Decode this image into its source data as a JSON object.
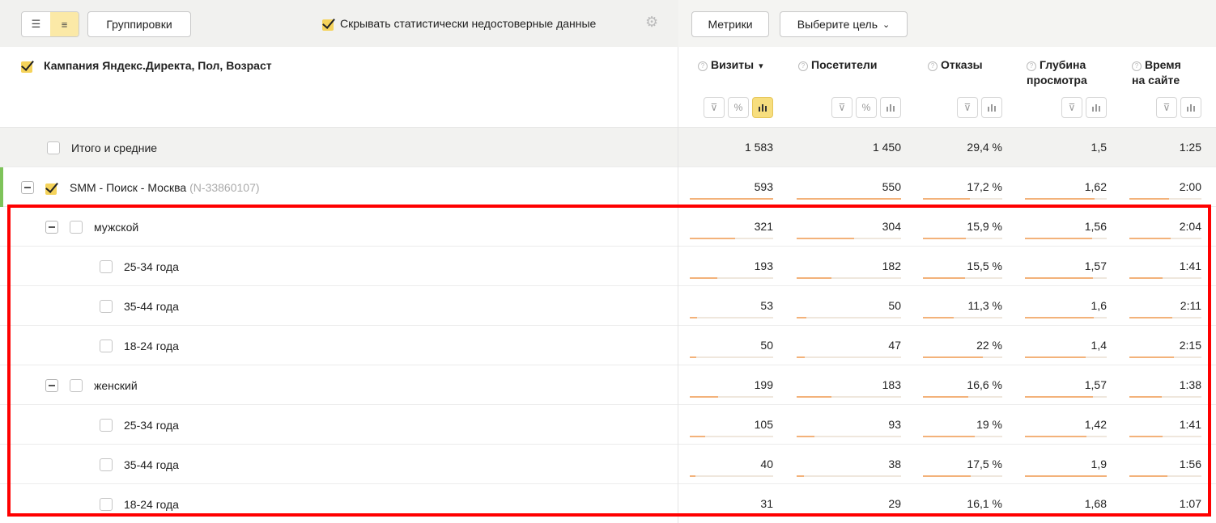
{
  "toolbar": {
    "view_list_icon": "list-icon",
    "view_tree_icon": "tree-icon",
    "groupings_label": "Группировки",
    "hide_unreliable_label": "Скрывать статистически недостоверные данные",
    "hide_unreliable_checked": true,
    "metrics_label": "Метрики",
    "goal_label": "Выберите цель"
  },
  "header": {
    "dimensions_title": "Кампания Яндекс.Директа, Пол, Возраст",
    "metrics": [
      {
        "line1": "Визиты",
        "line2": "",
        "sorted": true,
        "sort_arrow": "▾",
        "tools": [
          "filter",
          "percent",
          "chart"
        ]
      },
      {
        "line1": "Посетители",
        "line2": "",
        "tools": [
          "filter",
          "percent",
          "chart"
        ]
      },
      {
        "line1": "Отказы",
        "line2": "",
        "tools": [
          "filter",
          "chart"
        ]
      },
      {
        "line1": "Глубина",
        "line2": "просмотра",
        "tools": [
          "filter",
          "chart"
        ]
      },
      {
        "line1": "Время",
        "line2": "на сайте",
        "tools": [
          "filter",
          "chart"
        ]
      }
    ]
  },
  "rows": [
    {
      "label": "Итого и средние",
      "id": "",
      "level": 0,
      "type": "total",
      "values": [
        "1 583",
        "1 450",
        "29,4 %",
        "1,5",
        "1:25"
      ],
      "bars": null
    },
    {
      "label": "SMM - Поиск - Москва",
      "id": "(N-33860107)",
      "level": 0,
      "type": "campaign",
      "checked": true,
      "values": [
        "593",
        "550",
        "17,2 %",
        "1,62",
        "2:00"
      ],
      "bars": [
        1.0,
        1.0,
        0.59,
        0.85,
        0.55
      ]
    },
    {
      "label": "мужской",
      "id": "",
      "level": 1,
      "type": "group",
      "values": [
        "321",
        "304",
        "15,9 %",
        "1,56",
        "2:04"
      ],
      "bars": [
        0.54,
        0.55,
        0.54,
        0.82,
        0.57
      ]
    },
    {
      "label": "25-34 года",
      "id": "",
      "level": 2,
      "type": "leaf",
      "values": [
        "193",
        "182",
        "15,5 %",
        "1,57",
        "1:41"
      ],
      "bars": [
        0.33,
        0.33,
        0.53,
        0.83,
        0.46
      ]
    },
    {
      "label": "35-44 года",
      "id": "",
      "level": 2,
      "type": "leaf",
      "values": [
        "53",
        "50",
        "11,3 %",
        "1,6",
        "2:11"
      ],
      "bars": [
        0.09,
        0.09,
        0.39,
        0.84,
        0.6
      ]
    },
    {
      "label": "18-24 года",
      "id": "",
      "level": 2,
      "type": "leaf",
      "values": [
        "50",
        "47",
        "22 %",
        "1,4",
        "2:15"
      ],
      "bars": [
        0.08,
        0.08,
        0.75,
        0.74,
        0.62
      ]
    },
    {
      "label": "женский",
      "id": "",
      "level": 1,
      "type": "group",
      "values": [
        "199",
        "183",
        "16,6 %",
        "1,57",
        "1:38"
      ],
      "bars": [
        0.34,
        0.33,
        0.57,
        0.83,
        0.45
      ]
    },
    {
      "label": "25-34 года",
      "id": "",
      "level": 2,
      "type": "leaf",
      "values": [
        "105",
        "93",
        "19 %",
        "1,42",
        "1:41"
      ],
      "bars": [
        0.18,
        0.17,
        0.65,
        0.75,
        0.46
      ]
    },
    {
      "label": "35-44 года",
      "id": "",
      "level": 2,
      "type": "leaf",
      "values": [
        "40",
        "38",
        "17,5 %",
        "1,9",
        "1:56"
      ],
      "bars": [
        0.07,
        0.07,
        0.6,
        1.0,
        0.53
      ]
    },
    {
      "label": "18-24 года",
      "id": "",
      "level": 2,
      "type": "leaf",
      "values": [
        "31",
        "29",
        "16,1 %",
        "1,68",
        "1:07"
      ],
      "bars": [
        0.05,
        0.05,
        0.55,
        0.88,
        0.31
      ]
    }
  ],
  "colors": {
    "accent_yellow": "#f7de7e",
    "bar_fill": "#f3b27a",
    "highlight_red": "#ff0000",
    "campaign_marker": "#7ec35a"
  }
}
